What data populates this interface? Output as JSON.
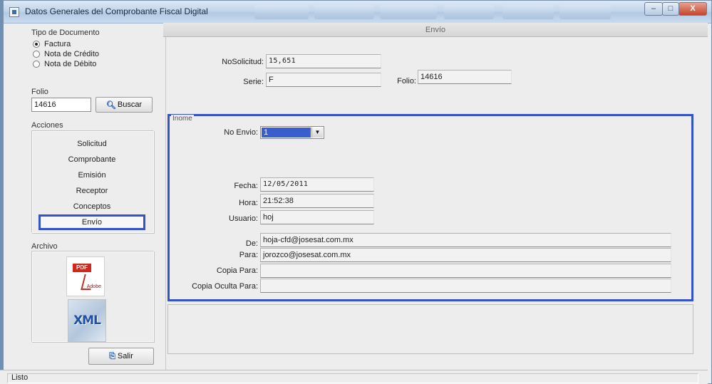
{
  "window": {
    "title": "Datos Generales del Comprobante Fiscal Digital",
    "controls": {
      "minimize": "–",
      "maximize": "□",
      "close": "X"
    }
  },
  "left": {
    "tipo_documento": {
      "label": "Tipo de Documento",
      "options": [
        {
          "label": "Factura",
          "checked": true
        },
        {
          "label": "Nota de Crédito",
          "checked": false
        },
        {
          "label": "Nota de Débito",
          "checked": false
        }
      ]
    },
    "folio": {
      "label": "Folio",
      "value": "14616",
      "search_label": "Buscar"
    },
    "acciones": {
      "label": "Acciones",
      "items": [
        "Solicitud",
        "Comprobante",
        "Emisión",
        "Receptor",
        "Conceptos",
        "Envío"
      ],
      "selected": "Envío"
    },
    "archivo": {
      "label": "Archivo",
      "pdf_badge": "PDF",
      "pdf_brand": "Adobe",
      "xml_label": "XML"
    },
    "salir_label": "Salir"
  },
  "main": {
    "header": "Envío",
    "no_solicitud": {
      "label": "NoSolicitud:",
      "value": "15,651"
    },
    "serie": {
      "label": "Serie:",
      "value": "F"
    },
    "folio": {
      "label": "Folio:",
      "value": "14616"
    },
    "envio_group": {
      "title": "Inome",
      "no_envio": {
        "label": "No Envio:",
        "value": "1"
      },
      "fecha": {
        "label": "Fecha:",
        "value": "12/05/2011"
      },
      "hora": {
        "label": "Hora:",
        "value": "21:52:38"
      },
      "usuario": {
        "label": "Usuario:",
        "value": "hoj"
      },
      "de": {
        "label": "De:",
        "value": "hoja-cfd@josesat.com.mx"
      },
      "para": {
        "label": "Para:",
        "value": "jorozco@josesat.com.mx"
      },
      "copia_para": {
        "label": "Copia Para:",
        "value": ""
      },
      "copia_oculta": {
        "label": "Copia Oculta Para:",
        "value": ""
      }
    }
  },
  "status": {
    "text": "Listo"
  },
  "colors": {
    "accent": "#3552c9",
    "selection": "#3a5fcd",
    "pdf_red": "#d0281b",
    "xml_blue": "#1f4fa8"
  }
}
